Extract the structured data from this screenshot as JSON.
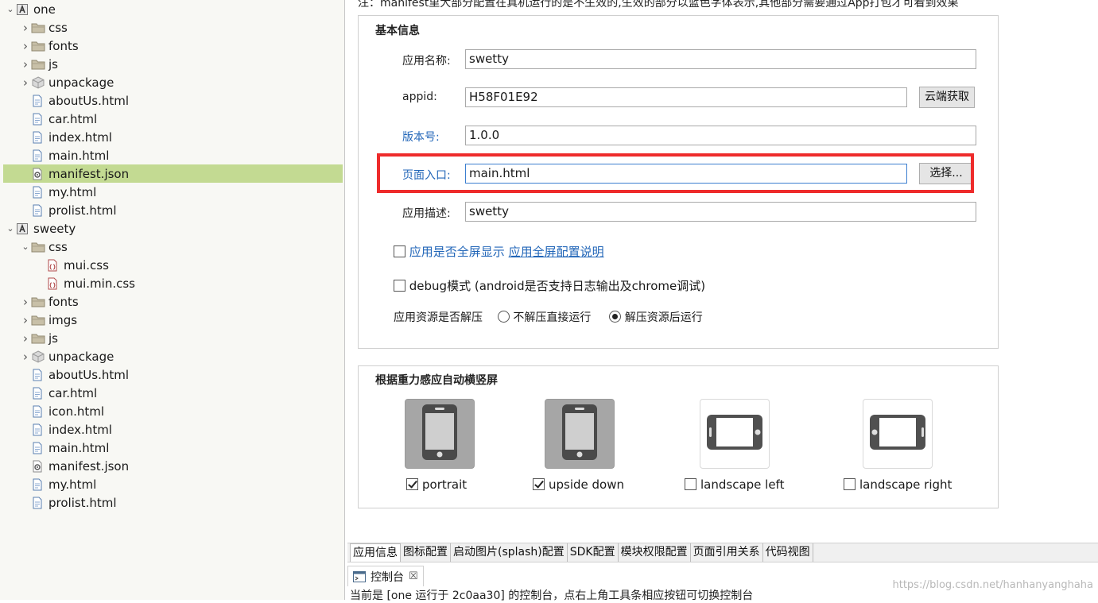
{
  "tree": {
    "items": [
      {
        "label": "one",
        "kind": "project",
        "toggle": "expanded",
        "level": 0
      },
      {
        "label": "css",
        "kind": "folder",
        "toggle": "collapsed",
        "level": 1
      },
      {
        "label": "fonts",
        "kind": "folder",
        "toggle": "collapsed",
        "level": 1
      },
      {
        "label": "js",
        "kind": "folder",
        "toggle": "collapsed",
        "level": 1
      },
      {
        "label": "unpackage",
        "kind": "package",
        "toggle": "collapsed",
        "level": 1
      },
      {
        "label": "aboutUs.html",
        "kind": "html",
        "toggle": "none",
        "level": 1
      },
      {
        "label": "car.html",
        "kind": "html",
        "toggle": "none",
        "level": 1
      },
      {
        "label": "index.html",
        "kind": "html",
        "toggle": "none",
        "level": 1
      },
      {
        "label": "main.html",
        "kind": "html",
        "toggle": "none",
        "level": 1
      },
      {
        "label": "manifest.json",
        "kind": "json",
        "toggle": "none",
        "level": 1,
        "selected": true
      },
      {
        "label": "my.html",
        "kind": "html",
        "toggle": "none",
        "level": 1
      },
      {
        "label": "prolist.html",
        "kind": "html",
        "toggle": "none",
        "level": 1
      },
      {
        "label": "sweety",
        "kind": "project",
        "toggle": "expanded",
        "level": 0
      },
      {
        "label": "css",
        "kind": "folder",
        "toggle": "expanded",
        "level": 1
      },
      {
        "label": "mui.css",
        "kind": "css",
        "toggle": "none",
        "level": 2
      },
      {
        "label": "mui.min.css",
        "kind": "css",
        "toggle": "none",
        "level": 2
      },
      {
        "label": "fonts",
        "kind": "folder",
        "toggle": "collapsed",
        "level": 1
      },
      {
        "label": "imgs",
        "kind": "folder",
        "toggle": "collapsed",
        "level": 1
      },
      {
        "label": "js",
        "kind": "folder",
        "toggle": "collapsed",
        "level": 1
      },
      {
        "label": "unpackage",
        "kind": "package",
        "toggle": "collapsed",
        "level": 1
      },
      {
        "label": "aboutUs.html",
        "kind": "html",
        "toggle": "none",
        "level": 1
      },
      {
        "label": "car.html",
        "kind": "html",
        "toggle": "none",
        "level": 1
      },
      {
        "label": "icon.html",
        "kind": "html",
        "toggle": "none",
        "level": 1
      },
      {
        "label": "index.html",
        "kind": "html",
        "toggle": "none",
        "level": 1
      },
      {
        "label": "main.html",
        "kind": "html",
        "toggle": "none",
        "level": 1
      },
      {
        "label": "manifest.json",
        "kind": "json",
        "toggle": "none",
        "level": 1
      },
      {
        "label": "my.html",
        "kind": "html",
        "toggle": "none",
        "level": 1
      },
      {
        "label": "prolist.html",
        "kind": "html",
        "toggle": "none",
        "level": 1
      }
    ]
  },
  "editor": {
    "notice": "注：manifest里大部分配置在真机运行的是不生效的,生效的部分以蓝色字体表示,其他部分需要通过App打包才可看到效果",
    "basic": {
      "title": "基本信息",
      "app_name_label": "应用名称:",
      "app_name_value": "swetty",
      "appid_label": "appid:",
      "appid_value": "H58F01E92",
      "appid_button": "云端获取",
      "version_label": "版本号:",
      "version_value": "1.0.0",
      "entry_label": "页面入口:",
      "entry_value": "main.html",
      "entry_button": "选择...",
      "desc_label": "应用描述:",
      "desc_value": "swetty",
      "fullscreen_label": "应用是否全屏显示",
      "fullscreen_link": "应用全屏配置说明",
      "fullscreen_checked": false,
      "debug_label": "debug模式 (android是否支持日志输出及chrome调试)",
      "debug_checked": false,
      "unzip_label": "应用资源是否解压",
      "unzip_options": [
        "不解压直接运行",
        "解压资源后运行"
      ],
      "unzip_selected": 1
    },
    "orientation": {
      "title": "根据重力感应自动横竖屏",
      "items": [
        {
          "label": "portrait",
          "checked": true
        },
        {
          "label": "upside down",
          "checked": true
        },
        {
          "label": "landscape left",
          "checked": false
        },
        {
          "label": "landscape right",
          "checked": false
        }
      ]
    }
  },
  "tabs": [
    "应用信息",
    "图标配置",
    "启动图片(splash)配置",
    "SDK配置",
    "模块权限配置",
    "页面引用关系",
    "代码视图"
  ],
  "active_tab": 0,
  "console": {
    "tab_label": "控制台",
    "tab_close": "☒",
    "line": "当前是 [one 运行于 2c0aa30] 的控制台，点右上角工具条相应按钮可切换控制台",
    "watermark": "https://blog.csdn.net/hanhanyanghaha"
  },
  "colors": {
    "selection": "#c3da92",
    "highlight_box": "#ee2b2b",
    "link_blue": "#2266b8",
    "tile_active": "#a6a6a6"
  }
}
